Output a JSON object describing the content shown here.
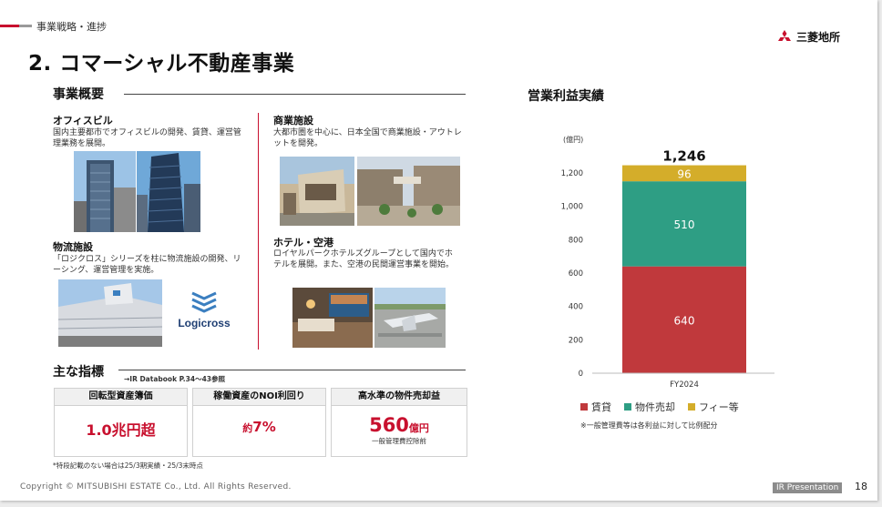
{
  "header": {
    "breadcrumb": "事業戦略・進捗",
    "title": "2. コマーシャル不動産事業",
    "logo_text": "三菱地所"
  },
  "overview": {
    "heading": "事業概要",
    "categories": [
      {
        "title": "オフィスビル",
        "desc": "国内主要都市でオフィスビルの開発、賃貸、運営管理業務を展開。"
      },
      {
        "title": "商業施設",
        "desc": "大都市圏を中心に、日本全国で商業施設・アウトレットを開発。"
      },
      {
        "title": "物流施設",
        "desc": "「ロジクロス」シリーズを柱に物流施設の開発、リーシング、運営管理を実施。"
      },
      {
        "title": "ホテル・空港",
        "desc": "ロイヤルパークホテルズグループとして国内でホテルを展開。また、空港の民間運営事業を開始。"
      }
    ],
    "logicross_logo": "Logicross"
  },
  "indicators": {
    "heading": "主な指標",
    "ref": "→IR Databook P.34～43参照",
    "items": [
      {
        "label": "回転型資産簿価",
        "value": "1.0兆円超",
        "prefix": "",
        "unit": "",
        "sub": ""
      },
      {
        "label": "稼働資産のNOI利回り",
        "value": "7%",
        "prefix": "約",
        "unit": "",
        "sub": ""
      },
      {
        "label": "高水準の物件売却益",
        "value": "560",
        "prefix": "",
        "unit": "億円",
        "sub": "一般管理費控除前"
      }
    ],
    "note": "*特段記載のない場合は25/3期実績・25/3末時点"
  },
  "chart_title": "営業利益実績",
  "chart_data": {
    "type": "bar",
    "stacked": true,
    "unit_label": "(億円)",
    "categories": [
      "FY2024"
    ],
    "series": [
      {
        "name": "賃貸",
        "values": [
          640
        ],
        "color": "#c0393c"
      },
      {
        "name": "物件売却",
        "values": [
          510
        ],
        "color": "#2e9e84"
      },
      {
        "name": "フィー等",
        "values": [
          96
        ],
        "color": "#d4ad2a"
      }
    ],
    "total_label": "1,246",
    "ylim": [
      0,
      1200
    ],
    "yticks": [
      "0",
      "200",
      "400",
      "600",
      "800",
      "1,000",
      "1,200"
    ],
    "legend_position": "bottom",
    "note": "※一般管理費等は各利益に対して比例配分"
  },
  "footer": {
    "copyright": "Copyright © MITSUBISHI ESTATE Co., Ltd. All Rights Reserved.",
    "badge": "IR Presentation",
    "page": "18"
  }
}
